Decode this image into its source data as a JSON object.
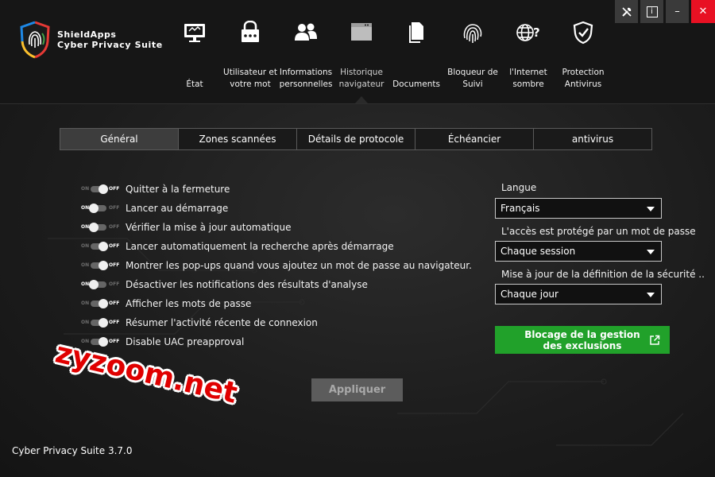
{
  "brand": {
    "line1": "ShieldApps",
    "line2": "Cyber Privacy Suite"
  },
  "nav": [
    {
      "label": "État",
      "icon": "monitor-icon",
      "active": false
    },
    {
      "label": "Utilisateur et votre mot",
      "icon": "lock-password-icon",
      "active": false
    },
    {
      "label": "Informations personnelles",
      "icon": "users-icon",
      "active": false
    },
    {
      "label": "Historique navigateur",
      "icon": "browser-window-icon",
      "active": true
    },
    {
      "label": "Documents",
      "icon": "documents-icon",
      "active": false
    },
    {
      "label": "Bloqueur de Suivi",
      "icon": "fingerprint-icon",
      "active": false
    },
    {
      "label": "l'Internet sombre",
      "icon": "globe-question-icon",
      "active": false
    },
    {
      "label": "Protection Antivirus",
      "icon": "shield-check-icon",
      "active": false
    }
  ],
  "window_controls": {
    "tools": "tools-icon",
    "info": "i",
    "minimize": "–",
    "close": "✕"
  },
  "tabs": [
    {
      "label": "Général",
      "active": true
    },
    {
      "label": "Zones scannées",
      "active": false
    },
    {
      "label": "Détails de protocole",
      "active": false
    },
    {
      "label": "Échéancier",
      "active": false
    },
    {
      "label": "antivirus",
      "active": false
    }
  ],
  "toggle_text": {
    "on": "ON",
    "off": "OFF"
  },
  "options": [
    {
      "label": "Quitter à la fermeture",
      "state": "off"
    },
    {
      "label": "Lancer au démarrage",
      "state": "on"
    },
    {
      "label": "Vérifier la mise à jour automatique",
      "state": "on"
    },
    {
      "label": "Lancer automatiquement la recherche après démarrage",
      "state": "off"
    },
    {
      "label": "Montrer les pop-ups quand vous ajoutez un mot de passe au navigateur.",
      "state": "off"
    },
    {
      "label": "Désactiver les notifications des résultats d'analyse",
      "state": "on"
    },
    {
      "label": "Afficher les mots de passe",
      "state": "off"
    },
    {
      "label": "Résumer l'activité récente de connexion",
      "state": "off"
    },
    {
      "label": "Disable UAC preapproval",
      "state": "off"
    }
  ],
  "settings": {
    "language_label": "Langue",
    "language_value": "Français",
    "access_label": "L'accès est protégé par un mot de passe",
    "access_value": "Chaque session",
    "update_label": "Mise à jour de la définition de la sécurité ..",
    "update_value": "Chaque jour"
  },
  "exclusions_button": "Blocage de la gestion des exclusions",
  "apply_button": "Appliquer",
  "version": "Cyber Privacy Suite 3.7.0",
  "watermark": "zyzoom.net",
  "colors": {
    "accent_green": "#21a12a",
    "close_red": "#e81123",
    "background": "#1c1c1c"
  }
}
